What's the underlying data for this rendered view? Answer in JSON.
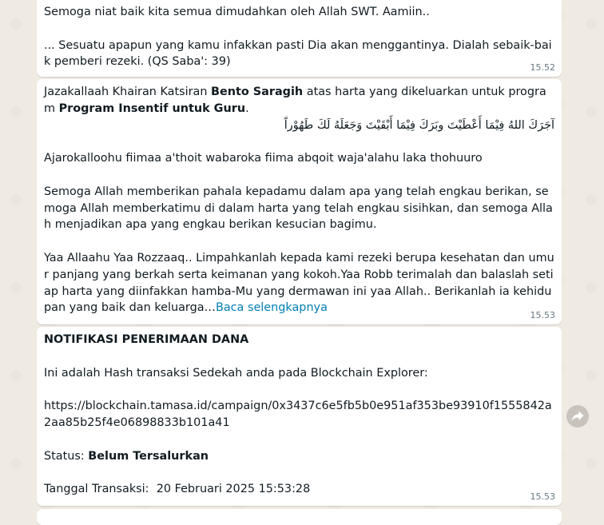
{
  "messages": [
    {
      "paragraphs": [
        "Semoga niat baik kita semua dimudahkan oleh Allah SWT. Aamiin..",
        "... Sesuatu apapun yang kamu infakkan pasti Dia akan menggantinya. Dialah sebaik-baik pemberi rezeki. (QS Saba': 39)"
      ],
      "time": "15.52"
    },
    {
      "intro_prefix": "Jazakallaah Khairan Katsiran ",
      "donor_name": "Bento Saragih",
      "intro_middle": " atas harta yang dikeluarkan untuk program ",
      "program_name": "Program Insentif untuk Guru",
      "intro_suffix": ".",
      "arabic": "آجَرَكَ اللهُ فِيْمَا أَعْطَيْتَ وبَرَكَ فِيْمَا أَبْقَيْتَ وَجَعَلَهُ لَكَ طَهُوْراً",
      "transliteration": "Ajarokalloohu fiimaa a'thoit wabaroka fiima abqoit waja'alahu laka thohuuro",
      "prayer": "Semoga Allah memberikan pahala kepadamu dalam apa yang telah engkau berikan, semoga Allah memberkatimu di dalam harta yang telah engkau sisihkan, dan semoga Allah menjadikan apa yang engkau berikan kesucian bagimu.",
      "doa": "Yaa Allaahu Yaa Rozzaaq.. Limpahkanlah kepada kami rezeki berupa kesehatan dan umur panjang yang berkah serta keimanan yang kokoh.Yaa Robb terimalah dan balaslah setiap harta yang diinfakkan hamba-Mu yang dermawan ini yaa Allah.. Berikanlah ia kehidupan yang baik dan keluarga…",
      "read_more": "Baca selengkapnya",
      "time": "15.53"
    },
    {
      "title": "NOTIFIKASI PENERIMAAN DANA",
      "hash_intro": "Ini adalah Hash transaksi Sedekah anda pada Blockchain Explorer:",
      "url": "https://blockchain.tamasa.id/campaign/0x3437c6e5fb5b0e951af353be93910f1555842a2aa85b25f4e06898833b101a41",
      "status_label": "Status: ",
      "status_value": "Belum Tersalurkan",
      "date_label": "Tanggal Transaksi:  ",
      "date_value": "20 Februari 2025 15:53:28",
      "time": "15.53"
    }
  ],
  "icons": {
    "forward": "forward-arrow-icon"
  },
  "colors": {
    "chat_background": "#efeae2",
    "bubble": "#ffffff",
    "link": "#027eb5",
    "timestamp": "#667781"
  }
}
